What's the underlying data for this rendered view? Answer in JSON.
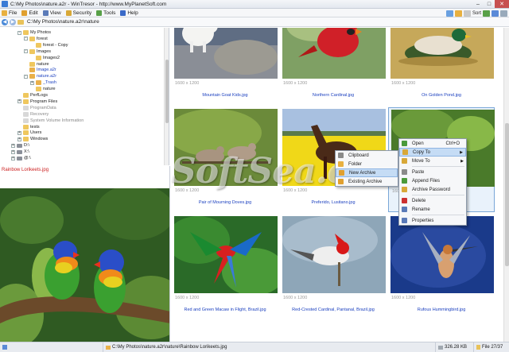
{
  "window": {
    "title": "C:\\My Photos\\nature.a2r - WinTresor - http://www.MyPlanetSoft.com",
    "minimize_glyph": "–",
    "maximize_glyph": "□",
    "close_glyph": "✕"
  },
  "menubar": {
    "items": [
      {
        "label": "File",
        "icon": "folder-icon",
        "color": "#e8b040"
      },
      {
        "label": "Edit",
        "icon": "edit-icon",
        "color": "#e0a030"
      },
      {
        "label": "View",
        "icon": "view-icon",
        "color": "#5a7ab8"
      },
      {
        "label": "Security",
        "icon": "security-icon",
        "color": "#d8a838"
      },
      {
        "label": "Tools",
        "icon": "tools-icon",
        "color": "#58a048"
      },
      {
        "label": "Help",
        "icon": "help-icon",
        "color": "#3a6ac8"
      }
    ]
  },
  "toolbar": {
    "sort_label": "Sort"
  },
  "address": {
    "back_glyph": "◀",
    "forward_glyph": "▶",
    "path": "C:\\My Photos\\nature.a2r\\nature"
  },
  "tree": {
    "rows": [
      {
        "label": "My Photos",
        "type": "folder",
        "exp": "-",
        "indent": 0,
        "style": ""
      },
      {
        "label": "forest",
        "type": "folder",
        "exp": "-",
        "indent": 1,
        "style": ""
      },
      {
        "label": "forest - Copy",
        "type": "folder",
        "exp": "",
        "indent": 2,
        "style": ""
      },
      {
        "label": "Images",
        "type": "folder",
        "exp": "-",
        "indent": 1,
        "style": ""
      },
      {
        "label": "Images2",
        "type": "folder",
        "exp": "",
        "indent": 2,
        "style": ""
      },
      {
        "label": "nature",
        "type": "folder",
        "exp": "",
        "indent": 1,
        "style": ""
      },
      {
        "label": "Image.a2r",
        "type": "archive",
        "exp": "",
        "indent": 1,
        "style": "blue"
      },
      {
        "label": "nature.a2r",
        "type": "archive",
        "exp": "-",
        "indent": 1,
        "style": "blue"
      },
      {
        "label": "_Trash",
        "type": "archive",
        "exp": "+",
        "indent": 2,
        "style": "blue"
      },
      {
        "label": "nature",
        "type": "folder",
        "exp": "",
        "indent": 2,
        "style": ""
      },
      {
        "label": "PerfLogs",
        "type": "folder",
        "exp": "",
        "indent": 0,
        "style": ""
      },
      {
        "label": "Program Files",
        "type": "folder",
        "exp": "+",
        "indent": 0,
        "style": ""
      },
      {
        "label": "ProgramData",
        "type": "sys",
        "exp": "",
        "indent": 0,
        "style": "grey"
      },
      {
        "label": "Recovery",
        "type": "sys",
        "exp": "",
        "indent": 0,
        "style": "grey"
      },
      {
        "label": "System Volume Information",
        "type": "sys",
        "exp": "",
        "indent": 0,
        "style": "grey"
      },
      {
        "label": "tests",
        "type": "folder",
        "exp": "",
        "indent": 0,
        "style": ""
      },
      {
        "label": "Users",
        "type": "folder",
        "exp": "+",
        "indent": 0,
        "style": ""
      },
      {
        "label": "Windows",
        "type": "folder",
        "exp": "+",
        "indent": 0,
        "style": ""
      },
      {
        "label": "D:\\",
        "type": "drive",
        "exp": "+",
        "indent": -1,
        "style": ""
      },
      {
        "label": "X:\\",
        "type": "drive",
        "exp": "+",
        "indent": -1,
        "style": ""
      },
      {
        "label": "@:\\",
        "type": "drive",
        "exp": "+",
        "indent": -1,
        "style": ""
      }
    ]
  },
  "preview": {
    "title": "Rainbow Lorikeets.jpg"
  },
  "grid": {
    "items": [
      {
        "dims": "1600 x 1200",
        "name": "Mountain Goat Kids.jpg",
        "scene": "goat"
      },
      {
        "dims": "1600 x 1200",
        "name": "Northern Cardinal.jpg",
        "scene": "cardinal"
      },
      {
        "dims": "1600 x 1200",
        "name": "On Golden Pond.jpg",
        "scene": "duck"
      },
      {
        "dims": "1600 x 1200",
        "name": "Pair of Mourning Doves.jpg",
        "scene": "doves"
      },
      {
        "dims": "1600 x 1200",
        "name": "Preferido, Lusitano.jpg",
        "scene": "horse"
      },
      {
        "dims": "1600 x 1200",
        "name": "",
        "scene": "bird"
      },
      {
        "dims": "1600 x 1200",
        "name": "Red and Green Macaw in Flight, Brazil.jpg",
        "scene": "macaw"
      },
      {
        "dims": "1600 x 1200",
        "name": "Red-Crested Cardinal, Pantanal, Brazil.jpg",
        "scene": "crested"
      },
      {
        "dims": "1600 x 1200",
        "name": "Rufous Hummingbird.jpg",
        "scene": "humming"
      }
    ]
  },
  "watermark": "SoftSea.com",
  "context_menu": {
    "items": [
      {
        "label": "Open",
        "shortcut": "Ctrl+O",
        "icon": "open-icon",
        "color": "#4a9a3a",
        "sep_after": false,
        "submenu": false
      },
      {
        "label": "Copy To",
        "shortcut": "",
        "icon": "copy-to-icon",
        "color": "#d8a838",
        "sep_after": false,
        "submenu": true,
        "highlight": true
      },
      {
        "label": "Move To",
        "shortcut": "",
        "icon": "move-to-icon",
        "color": "#d8a838",
        "sep_after": true,
        "submenu": true
      },
      {
        "label": "Paste",
        "shortcut": "",
        "icon": "paste-icon",
        "color": "#8a8a8a",
        "sep_after": false,
        "submenu": false
      },
      {
        "label": "Append Files",
        "shortcut": "",
        "icon": "append-files-icon",
        "color": "#4a9a3a",
        "sep_after": false,
        "submenu": false
      },
      {
        "label": "Archive Password",
        "shortcut": "",
        "icon": "key-icon",
        "color": "#d8a838",
        "sep_after": true,
        "submenu": false
      },
      {
        "label": "Delete",
        "shortcut": "",
        "icon": "delete-icon",
        "color": "#cc3030",
        "sep_after": false,
        "submenu": false
      },
      {
        "label": "Rename",
        "shortcut": "",
        "icon": "rename-icon",
        "color": "#5a7ab8",
        "sep_after": true,
        "submenu": false
      },
      {
        "label": "Properties",
        "shortcut": "",
        "icon": "properties-icon",
        "color": "#5a7ab8",
        "sep_after": false,
        "submenu": false
      }
    ],
    "submenu": [
      {
        "label": "Clipboard",
        "icon": "clipboard-icon",
        "color": "#8a8a8a"
      },
      {
        "label": "Folder",
        "icon": "folder-icon",
        "color": "#e8b040"
      },
      {
        "label": "New Archive",
        "icon": "new-archive-icon",
        "color": "#e0a030",
        "highlight": true
      },
      {
        "label": "Existing Archive",
        "icon": "existing-archive-icon",
        "color": "#e0a030"
      }
    ]
  },
  "statusbar": {
    "path": "C:\\My Photos\\nature.a2r\\nature\\Rainbow Lorikeets.jpg",
    "size": "326.28 KB",
    "files": "File 27/37"
  }
}
